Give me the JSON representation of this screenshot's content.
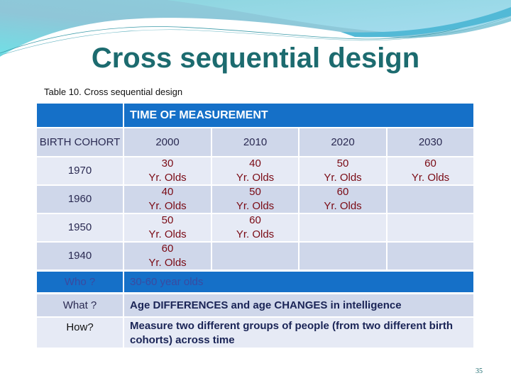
{
  "slide": {
    "title": "Cross sequential design",
    "caption": "Table  10. Cross sequential design",
    "page_number": "35"
  },
  "table": {
    "header": "TIME OF MEASUREMENT",
    "corner_label": "BIRTH COHORT",
    "years": [
      "2000",
      "2010",
      "2020",
      "2030"
    ],
    "rows": [
      {
        "cohort": "1970",
        "cells": [
          {
            "n": "30",
            "u": "Yr. Olds"
          },
          {
            "n": "40",
            "u": "Yr. Olds"
          },
          {
            "n": "50",
            "u": "Yr. Olds"
          },
          {
            "n": "60",
            "u": "Yr. Olds"
          }
        ]
      },
      {
        "cohort": "1960",
        "cells": [
          {
            "n": "40",
            "u": "Yr. Olds"
          },
          {
            "n": "50",
            "u": "Yr. Olds"
          },
          {
            "n": "60",
            "u": "Yr. Olds"
          },
          {
            "n": "",
            "u": ""
          }
        ]
      },
      {
        "cohort": "1950",
        "cells": [
          {
            "n": "50",
            "u": "Yr. Olds"
          },
          {
            "n": "60",
            "u": "Yr. Olds"
          },
          {
            "n": "",
            "u": ""
          },
          {
            "n": "",
            "u": ""
          }
        ]
      },
      {
        "cohort": "1940",
        "cells": [
          {
            "n": "60",
            "u": "Yr. Olds"
          },
          {
            "n": "",
            "u": ""
          },
          {
            "n": "",
            "u": ""
          },
          {
            "n": "",
            "u": ""
          }
        ]
      }
    ],
    "summary": [
      {
        "label": "Who ?",
        "value": "30-60 year olds"
      },
      {
        "label": "What ?",
        "value": "Age DIFFERENCES and age CHANGES in intelligence"
      },
      {
        "label": "How?",
        "value": "Measure two different groups of people (from two different birth cohorts) across time"
      }
    ]
  },
  "colors": {
    "title": "#1c6b6f",
    "header_blue": "#1570c8",
    "row_dark": "#cfd7ea",
    "row_light": "#e6eaf5",
    "age_text": "#7a0a14"
  }
}
